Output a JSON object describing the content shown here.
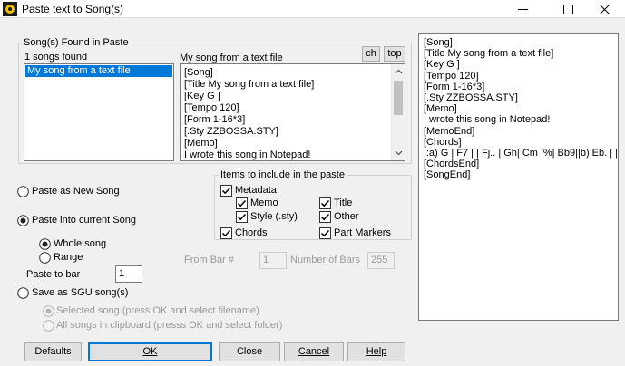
{
  "window": {
    "title": "Paste text to Song(s)"
  },
  "found_group": {
    "label": "Song(s) Found in Paste",
    "count_text": "1 songs found",
    "songs": [
      "My song from a text file"
    ],
    "preview_title": "My song from a text file",
    "ch_label": "ch",
    "top_label": "top",
    "preview_lines": [
      "[Song]",
      "[Title My song from a text file]",
      "[Key G ]",
      "[Tempo 120]",
      "[Form 1-16*3]",
      "[.Sty ZZBOSSA.STY]",
      "[Memo]",
      "I wrote this song in Notepad!",
      "[MemoEnd]"
    ]
  },
  "paste_options": {
    "new_song": "Paste as New Song",
    "current_song": "Paste into current Song",
    "whole_song": "Whole song",
    "range": "Range",
    "paste_to_bar_label": "Paste to bar",
    "paste_to_bar_value": "1",
    "from_bar_label": "From Bar #",
    "from_bar_value": "1",
    "num_bars_label": "Number of Bars",
    "num_bars_value": "255",
    "save_sgu": "Save as SGU song(s)",
    "selected_song": "Selected song (press OK and select filename)",
    "all_songs": "All songs in clipboard (presss OK and select folder)"
  },
  "items_group": {
    "label": "Items to include in the paste",
    "metadata": "Metadata",
    "memo": "Memo",
    "title": "Title",
    "style": "Style (.sty)",
    "other": "Other",
    "chords": "Chords",
    "part_markers": "Part Markers"
  },
  "right_preview": {
    "lines": [
      "[Song]",
      "[Title My song from a text file]",
      "[Key G ]",
      "[Tempo 120]",
      "[Form 1-16*3]",
      "[.Sty ZZBOSSA.STY]",
      "[Memo]",
      "I wrote this song in Notepad!",
      "[MemoEnd]",
      "[Chords]",
      "|:a) G | F7 |  | Fj.. | Gh| Cm |%| Bb9||b) Eb. | |",
      "[ChordsEnd]",
      "[SongEnd]"
    ]
  },
  "buttons": {
    "defaults": "Defaults",
    "ok": "OK",
    "close": "Close",
    "cancel": "Cancel",
    "help": "Help"
  },
  "colors": {
    "accent": "#0078d7",
    "window_bg": "#f0f0f0"
  }
}
